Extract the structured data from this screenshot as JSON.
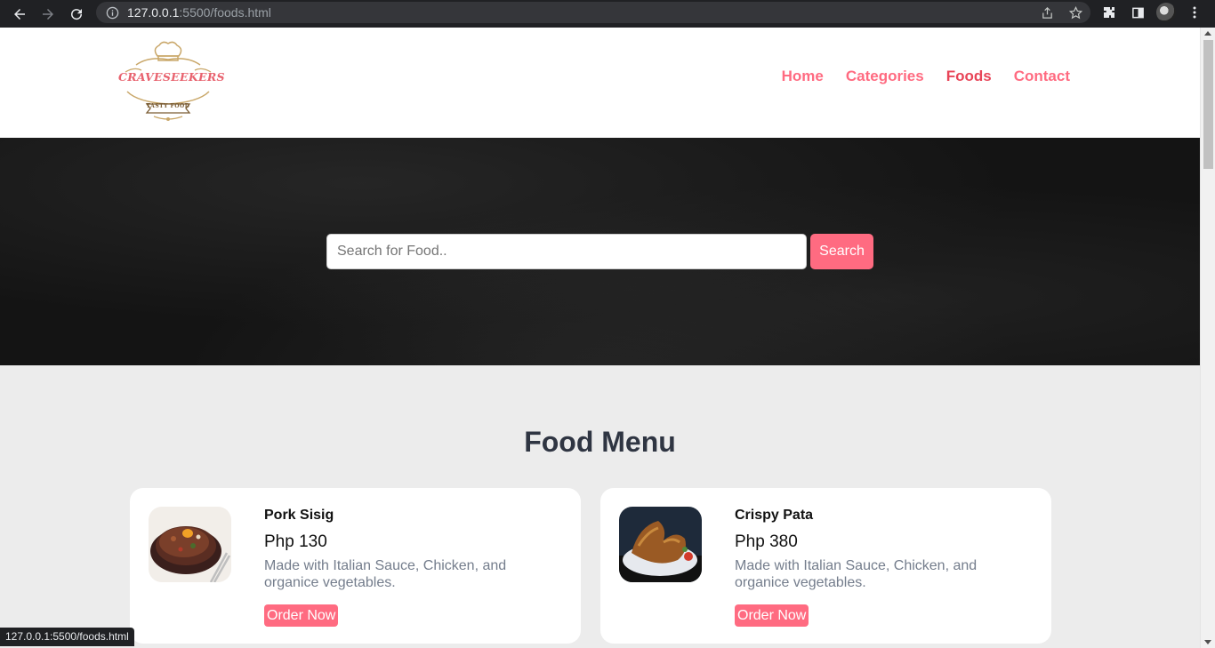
{
  "browser": {
    "url_host": "127.0.0.1",
    "url_path": ":5500/foods.html",
    "status_url": "127.0.0.1:5500/foods.html"
  },
  "site": {
    "logo_text": "CRAVESEEKERS",
    "logo_subtext": "TASTY FOOD",
    "nav": [
      {
        "label": "Home"
      },
      {
        "label": "Categories"
      },
      {
        "label": "Foods"
      },
      {
        "label": "Contact"
      }
    ]
  },
  "search": {
    "placeholder": "Search for Food..",
    "button_label": "Search"
  },
  "food_menu": {
    "title": "Food Menu",
    "items": [
      {
        "name": "Pork Sisig",
        "price": "Php 130",
        "description": "Made with Italian Sauce, Chicken, and organice vegetables.",
        "button_label": "Order Now"
      },
      {
        "name": "Crispy Pata",
        "price": "Php 380",
        "description": "Made with Italian Sauce, Chicken, and organice vegetables.",
        "button_label": "Order Now"
      }
    ]
  },
  "colors": {
    "accent": "#ff6b81",
    "heading": "#2f3542",
    "text_muted": "#747d8c"
  }
}
